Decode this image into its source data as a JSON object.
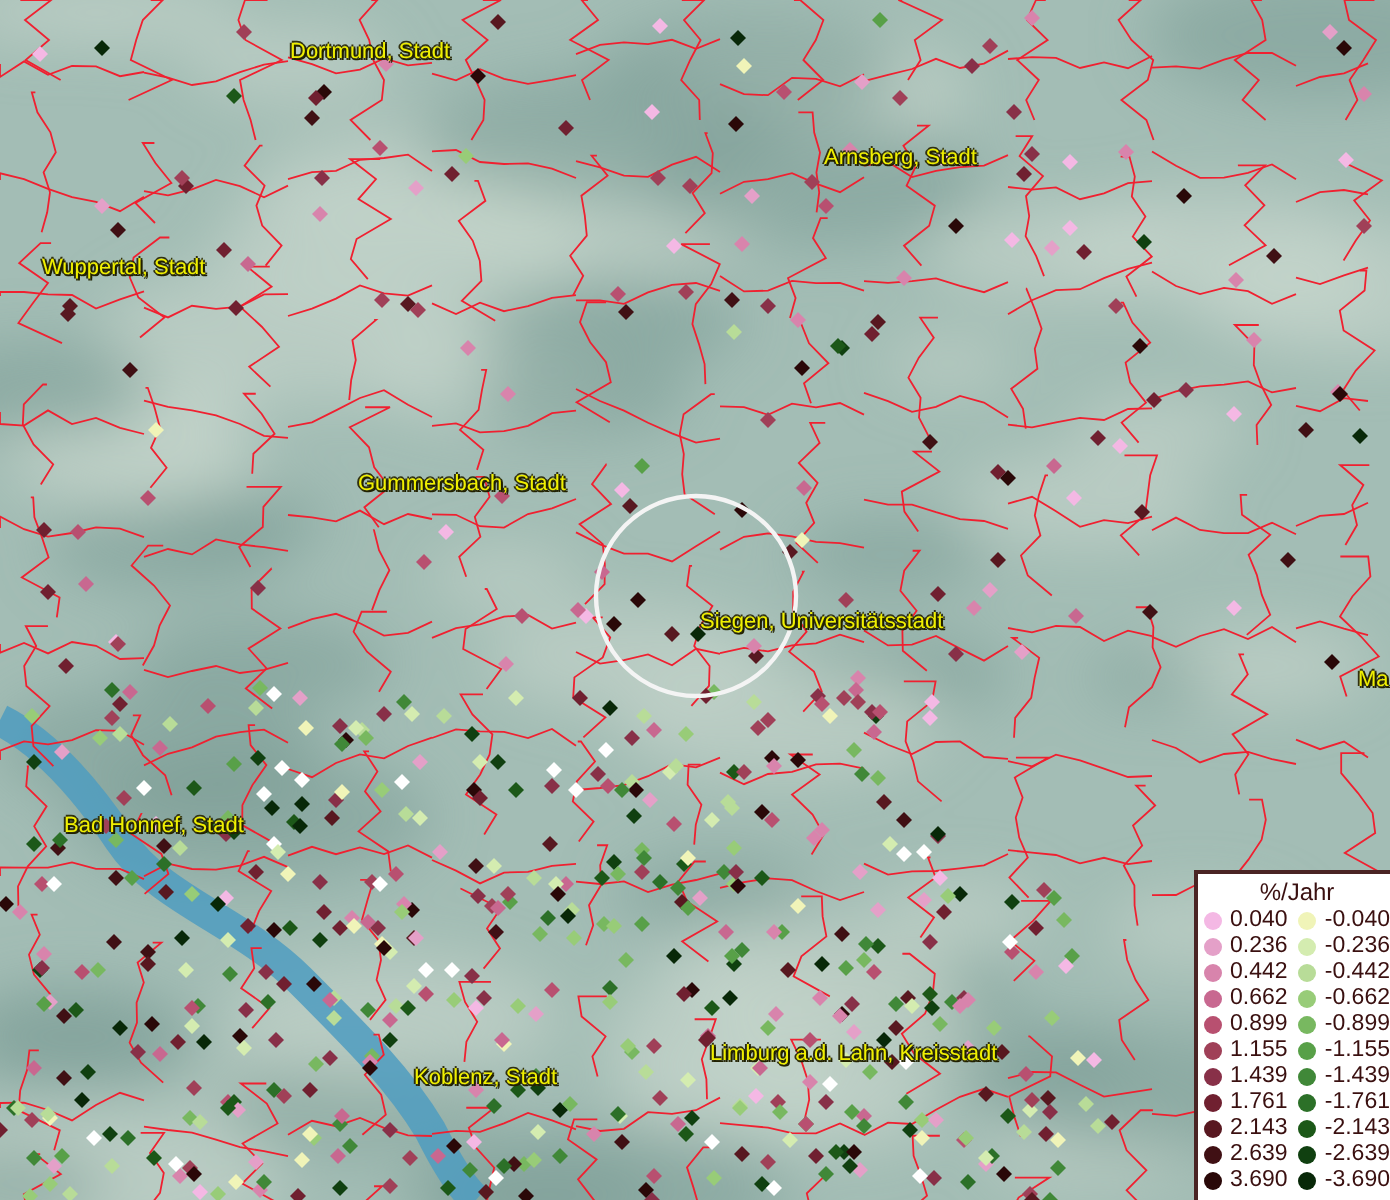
{
  "map": {
    "places": [
      {
        "label": "Dortmund, Stadt"
      },
      {
        "label": "Arnsberg, Stadt"
      },
      {
        "label": "Wuppertal, Stadt"
      },
      {
        "label": "Gummersbach, Stadt"
      },
      {
        "label": "Siegen, Universitätsstadt"
      },
      {
        "label": "Ma"
      },
      {
        "label": "Bad Honnef, Stadt"
      },
      {
        "label": "Limburg a.d. Lahn, Kreisstadt"
      },
      {
        "label": "Koblenz, Stadt"
      }
    ]
  },
  "legend": {
    "title": "%/Jahr",
    "positive": [
      {
        "label": "0.040",
        "color": "#f4b8e4"
      },
      {
        "label": "0.236",
        "color": "#e4a0c8"
      },
      {
        "label": "0.442",
        "color": "#d884ac"
      },
      {
        "label": "0.662",
        "color": "#c86890"
      },
      {
        "label": "0.899",
        "color": "#b85070"
      },
      {
        "label": "1.155",
        "color": "#a04058"
      },
      {
        "label": "1.439",
        "color": "#883048"
      },
      {
        "label": "1.761",
        "color": "#702030"
      },
      {
        "label": "2.143",
        "color": "#581820"
      },
      {
        "label": "2.639",
        "color": "#401014"
      },
      {
        "label": "3.690",
        "color": "#2a0808"
      }
    ],
    "negative": [
      {
        "label": "-0.040",
        "color": "#f0f4b8"
      },
      {
        "label": "-0.236",
        "color": "#d4ecb0"
      },
      {
        "label": "-0.442",
        "color": "#b8dc98"
      },
      {
        "label": "-0.662",
        "color": "#98cc78"
      },
      {
        "label": "-0.899",
        "color": "#78b860"
      },
      {
        "label": "-1.155",
        "color": "#58a048"
      },
      {
        "label": "-1.439",
        "color": "#408838"
      },
      {
        "label": "-1.761",
        "color": "#2c7028"
      },
      {
        "label": "-2.143",
        "color": "#1c5818"
      },
      {
        "label": "-2.639",
        "color": "#104010"
      },
      {
        "label": "-3.690",
        "color": "#082808"
      }
    ]
  }
}
